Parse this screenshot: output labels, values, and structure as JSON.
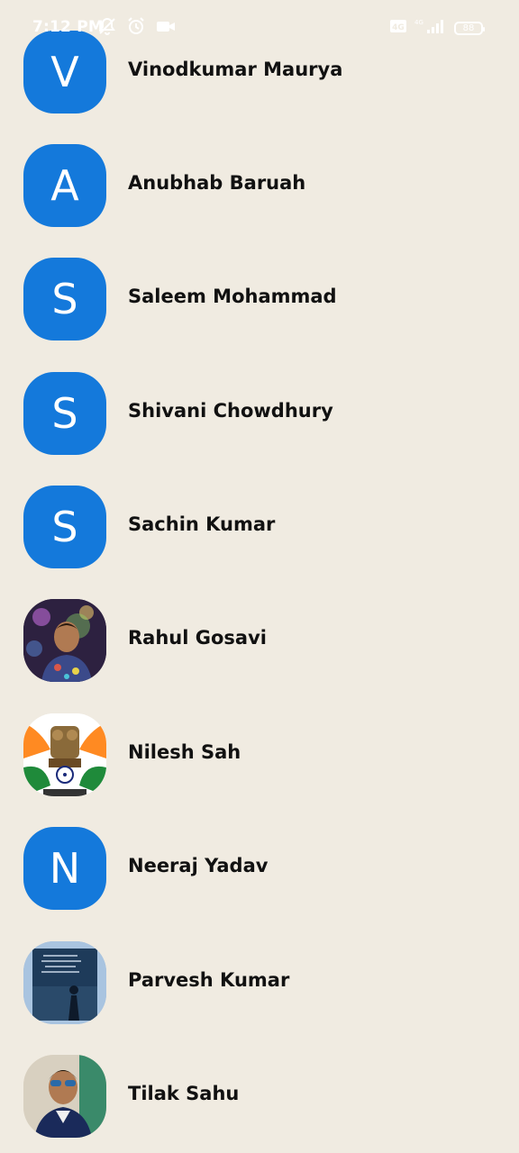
{
  "status_bar": {
    "time": "7:12 PM",
    "battery": "88",
    "icons_left": [
      "mute-icon",
      "alarm-icon",
      "video-icon"
    ],
    "icons_right": [
      "volte-icon",
      "signal-icon",
      "battery-icon"
    ]
  },
  "contacts": [
    {
      "name": "Vinodkumar Maurya",
      "initial": "V",
      "avatar_type": "letter"
    },
    {
      "name": "Anubhab Baruah",
      "initial": "A",
      "avatar_type": "letter"
    },
    {
      "name": "Saleem Mohammad",
      "initial": "S",
      "avatar_type": "letter"
    },
    {
      "name": "Shivani Chowdhury",
      "initial": "S",
      "avatar_type": "letter"
    },
    {
      "name": "Sachin Kumar",
      "initial": "S",
      "avatar_type": "letter"
    },
    {
      "name": "Rahul Gosavi",
      "initial": "",
      "avatar_type": "photo"
    },
    {
      "name": "Nilesh Sah",
      "initial": "",
      "avatar_type": "photo"
    },
    {
      "name": "Neeraj Yadav",
      "initial": "N",
      "avatar_type": "letter"
    },
    {
      "name": "Parvesh Kumar",
      "initial": "",
      "avatar_type": "photo"
    },
    {
      "name": "Tilak Sahu",
      "initial": "",
      "avatar_type": "photo"
    }
  ],
  "colors": {
    "background": "#f0ebe1",
    "avatar_blue": "#1479db",
    "name_text": "#111111"
  }
}
